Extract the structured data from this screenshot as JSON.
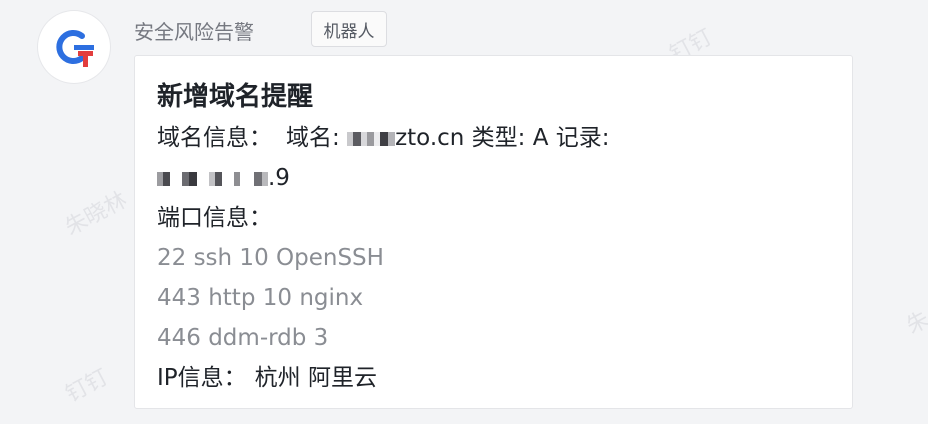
{
  "watermarks": [
    "钉钉",
    "朱晓林",
    "钉钉",
    "朱"
  ],
  "sender": {
    "name": "安全风险告警",
    "tag": "机器人",
    "avatar": {
      "icon": "robot-logo-icon",
      "colors": [
        "#2d6fe0",
        "#e23d3d"
      ]
    }
  },
  "card": {
    "title": "新增域名提醒",
    "domain_label": "域名信息：",
    "domain_name_label": "域名:",
    "domain_value_visible": "zto.cn",
    "type_label": "类型:",
    "type_value": "A",
    "record_label": "记录:",
    "record_value_visible": ".9",
    "ports_label": "端口信息：",
    "ports": [
      "22 ssh 10 OpenSSH",
      "443 http 10 nginx",
      "446 ddm-rdb 3"
    ],
    "ip_label": "IP信息：",
    "ip_value": "杭州 阿里云"
  }
}
